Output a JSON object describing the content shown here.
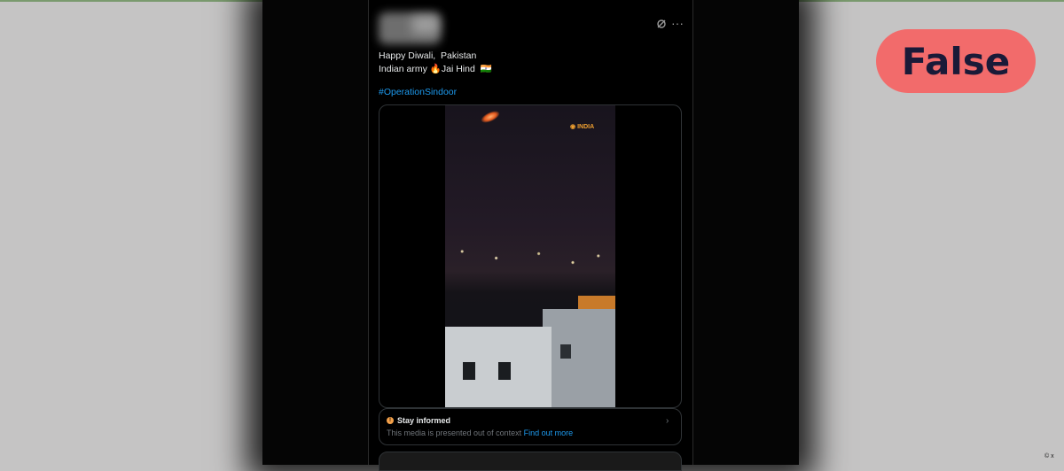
{
  "tweet": {
    "lines": [
      "Happy Diwali,  Pakistan",
      "Indian army 🔥Jai Hind  🇮🇳"
    ],
    "hashtag": "#OperationSindoor",
    "video_badge": "INDIA",
    "notice_title": "Stay informed",
    "notice_body": "This media is presented out of context",
    "notice_link": "Find out more"
  },
  "verdict": "False",
  "credit": "© x",
  "colors": {
    "verdict_bg": "#f26b6b",
    "verdict_text": "#1a1a38",
    "link": "#1d9bf0",
    "notice_icon": "#f4a14a"
  },
  "icons": {
    "grok": "grok-icon",
    "more": "more-dots-icon",
    "info": "info-icon",
    "chevron": "chevron-right-icon"
  }
}
